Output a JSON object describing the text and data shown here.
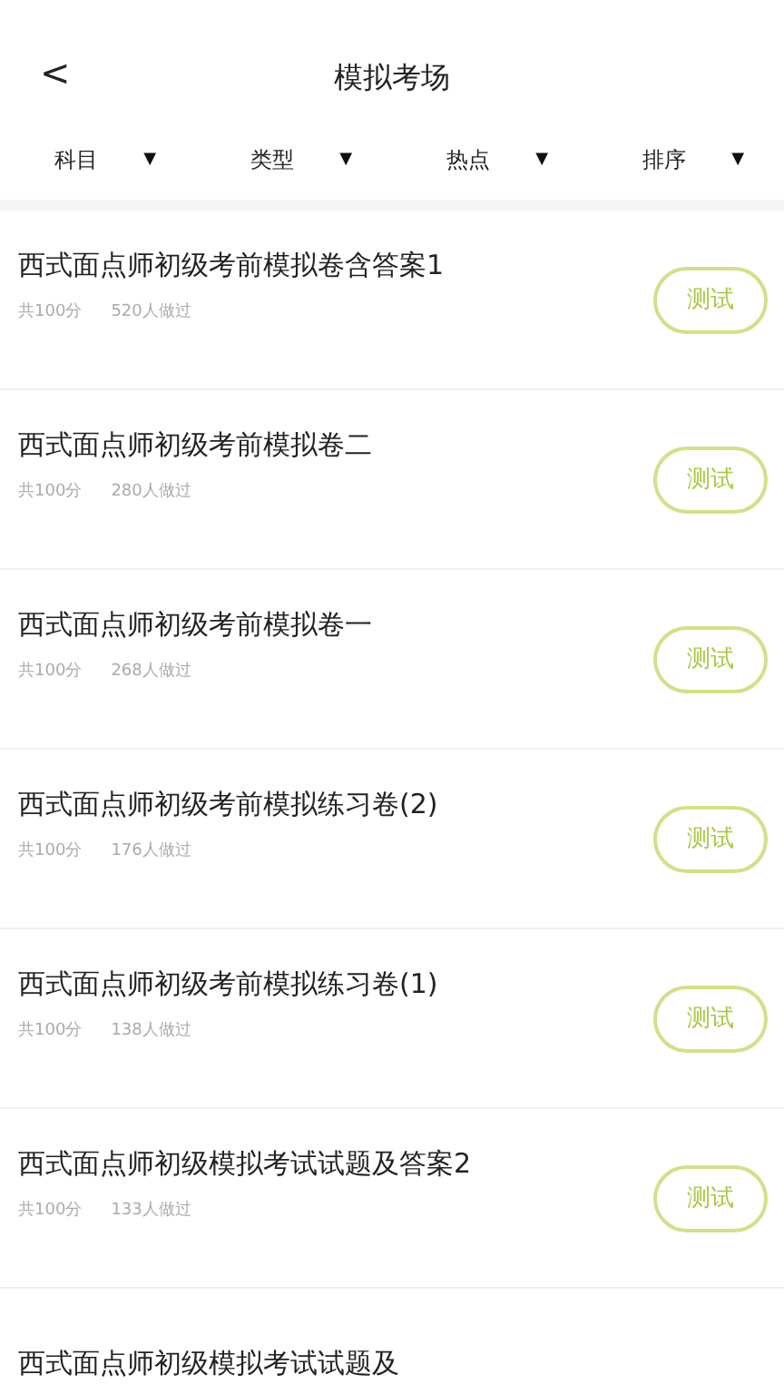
{
  "header": {
    "back": "<",
    "title": "模拟考场"
  },
  "filters": [
    {
      "label": "科目",
      "arrow": "▼"
    },
    {
      "label": "类型",
      "arrow": "▼"
    },
    {
      "label": "热点",
      "arrow": "▼"
    },
    {
      "label": "排序",
      "arrow": "▼"
    }
  ],
  "exams": [
    {
      "title": "西式面点师初级考前模拟卷含答案1",
      "score": "共100分",
      "taken": "520人做过",
      "action": "测试"
    },
    {
      "title": "西式面点师初级考前模拟卷二",
      "score": "共100分",
      "taken": "280人做过",
      "action": "测试"
    },
    {
      "title": "西式面点师初级考前模拟卷一",
      "score": "共100分",
      "taken": "268人做过",
      "action": "测试"
    },
    {
      "title": "西式面点师初级考前模拟练习卷(2)",
      "score": "共100分",
      "taken": "176人做过",
      "action": "测试"
    },
    {
      "title": "西式面点师初级考前模拟练习卷(1)",
      "score": "共100分",
      "taken": "138人做过",
      "action": "测试"
    },
    {
      "title": "西式面点师初级模拟考试试题及答案2",
      "score": "共100分",
      "taken": "133人做过",
      "action": "测试"
    },
    {
      "title": "西式面点师初级模拟考试试题及"
    }
  ]
}
